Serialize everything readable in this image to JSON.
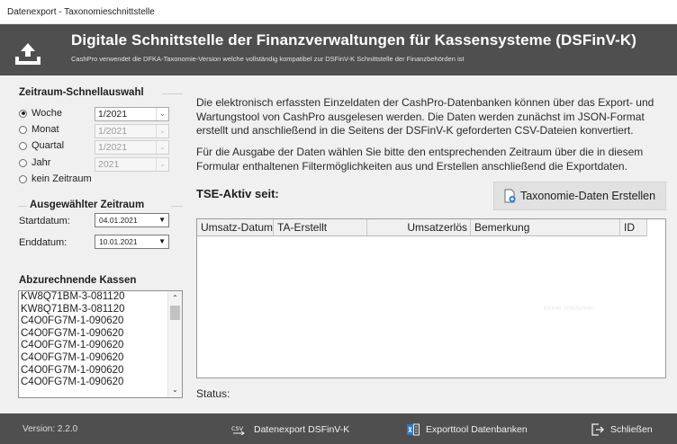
{
  "window": {
    "title": "Datenexport - Taxonomieschnittstelle"
  },
  "header": {
    "title": "Digitale Schnittstelle der Finanzverwaltungen für Kassensysteme (DSFinV-K)",
    "subtitle": "CashPro verwendet die DFKA-Taxonomie-Version welche vollständig kompatibel zur DSFinV-K Schnittstelle der Finanzbehörden ist",
    "icon": "upload-tray-icon"
  },
  "quick_select": {
    "label": "Zeitraum-Schnellauswahl",
    "options": [
      {
        "label": "Woche",
        "value": "1/2021",
        "selected": true,
        "enabled": true
      },
      {
        "label": "Monat",
        "value": "1/2021",
        "selected": false,
        "enabled": false
      },
      {
        "label": "Quartal",
        "value": "1/2021",
        "selected": false,
        "enabled": false
      },
      {
        "label": "Jahr",
        "value": "2021",
        "selected": false,
        "enabled": false
      },
      {
        "label": "kein Zeitraum",
        "selected": false
      }
    ]
  },
  "period": {
    "label": "Ausgewählter Zeitraum",
    "start_label": "Startdatum:",
    "start_value": "04.01.2021",
    "end_label": "Enddatum:",
    "end_value": "10.01.2021"
  },
  "registers": {
    "label": "Abzurechnende Kassen",
    "items": [
      "KW8Q71BM-3-081120",
      "KW8Q71BM-3-081120",
      "C4O0FG7M-1-090620",
      "C4O0FG7M-1-090620",
      "C4O0FG7M-1-090620",
      "C4O0FG7M-1-090620",
      "C4O0FG7M-1-090620",
      "C4O0FG7M-1-090620"
    ]
  },
  "info": {
    "paragraph1": "Die elektronisch erfassten Einzeldaten der CashPro-Datenbanken können über das Export- und Wartungstool von CashPro ausgelesen werden. Die Daten werden zunächst im JSON-Format erstellt und anschließend in die Seitens der DSFinV-K geforderten CSV-Dateien konvertiert.",
    "paragraph2": "Für die Ausgabe der Daten wählen Sie bitte den entsprechenden Zeitraum über die in diesem Formular enthaltenen Filtermöglichkeiten aus und Erstellen anschließend die Exportdaten."
  },
  "tse": {
    "label": "TSE-Aktiv seit:"
  },
  "create_button": {
    "label": "Taxonomie-Daten Erstellen",
    "icon": "document-add-icon"
  },
  "grid": {
    "columns": [
      "Umsatz-Datum",
      "TA-Erstellt",
      "Umsatzerlös",
      "Bemerkung",
      "ID"
    ],
    "rows": [],
    "empty_watermark": "Keiner erschienen"
  },
  "status": {
    "label": "Status:"
  },
  "footer": {
    "version": "Version: 2.2.0",
    "datenexport_label": "Datenexport DSFinV-K",
    "datenexport_icon": "csv-export-icon",
    "exporttool_label": "Exporttool Datenbanken",
    "exporttool_icon": "database-export-icon",
    "close_label": "Schließen",
    "close_icon": "exit-icon"
  }
}
